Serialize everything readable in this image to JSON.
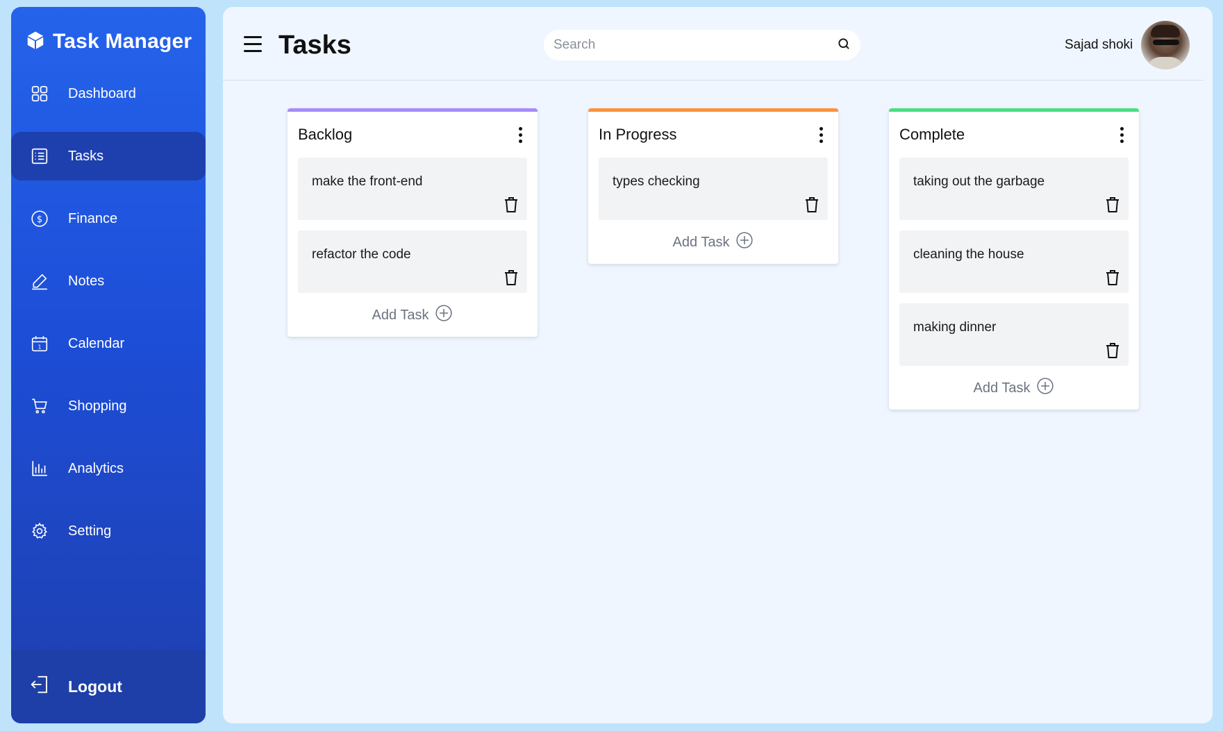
{
  "app": {
    "title": "Task Manager"
  },
  "sidebar": {
    "items": [
      {
        "label": "Dashboard",
        "icon": "grid-icon"
      },
      {
        "label": "Tasks",
        "icon": "list-icon"
      },
      {
        "label": "Finance",
        "icon": "dollar-icon"
      },
      {
        "label": "Notes",
        "icon": "pencil-icon"
      },
      {
        "label": "Calendar",
        "icon": "calendar-icon"
      },
      {
        "label": "Shopping",
        "icon": "cart-icon"
      },
      {
        "label": "Analytics",
        "icon": "chart-icon"
      },
      {
        "label": "Setting",
        "icon": "gear-icon"
      }
    ],
    "active": "Tasks",
    "logout_label": "Logout"
  },
  "header": {
    "title": "Tasks",
    "search_placeholder": "Search",
    "user_name": "Sajad shoki"
  },
  "board": {
    "add_task_label": "Add Task",
    "columns": [
      {
        "title": "Backlog",
        "accent": "#a78bfa",
        "tasks": [
          "make the front-end",
          "refactor the code"
        ]
      },
      {
        "title": "In Progress",
        "accent": "#fb923c",
        "tasks": [
          "types checking"
        ]
      },
      {
        "title": "Complete",
        "accent": "#4ade80",
        "tasks": [
          "taking out the garbage",
          "cleaning the house",
          "making dinner"
        ]
      }
    ]
  },
  "colors": {
    "sidebar_top": "#2563eb",
    "sidebar_bottom": "#1e3fae",
    "active_item": "#1e40af",
    "main_bg": "#eff6ff",
    "page_bg": "#bfe3fb"
  }
}
